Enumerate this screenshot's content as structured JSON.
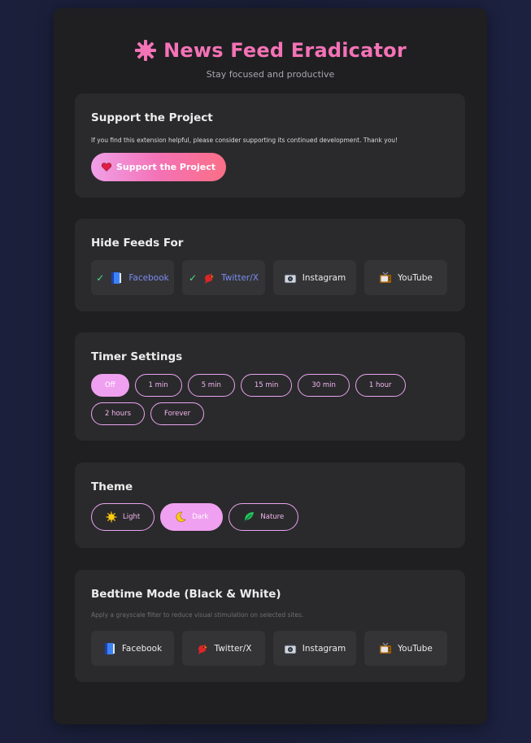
{
  "header": {
    "title": "News Feed Eradicator",
    "subtitle": "Stay focused and productive",
    "logo_icon": "pink-star-burst-icon"
  },
  "support": {
    "heading": "Support the Project",
    "description": "If you find this extension helpful, please consider supporting its continued development. Thank you!",
    "button_label": "Support the Project",
    "button_icon": "heart-icon"
  },
  "hide_feeds": {
    "heading": "Hide Feeds For",
    "sites": [
      {
        "label": "Facebook",
        "icon": "book-icon",
        "selected": true
      },
      {
        "label": "Twitter/X",
        "icon": "bird-icon",
        "selected": true
      },
      {
        "label": "Instagram",
        "icon": "camera-icon",
        "selected": false
      },
      {
        "label": "YouTube",
        "icon": "tv-icon",
        "selected": false
      }
    ]
  },
  "timer": {
    "heading": "Timer Settings",
    "options": [
      "Off",
      "1 min",
      "5 min",
      "15 min",
      "30 min",
      "1 hour",
      "2 hours",
      "Forever"
    ],
    "selected": "Off"
  },
  "theme": {
    "heading": "Theme",
    "options": [
      {
        "label": "Light",
        "icon": "sun-icon"
      },
      {
        "label": "Dark",
        "icon": "moon-icon"
      },
      {
        "label": "Nature",
        "icon": "leaf-icon"
      }
    ],
    "selected": "Dark"
  },
  "bedtime": {
    "heading": "Bedtime Mode (Black & White)",
    "description": "Apply a grayscale filter to reduce visual stimulation on selected sites.",
    "sites": [
      {
        "label": "Facebook",
        "icon": "book-icon"
      },
      {
        "label": "Twitter/X",
        "icon": "bird-icon"
      },
      {
        "label": "Instagram",
        "icon": "camera-icon"
      },
      {
        "label": "YouTube",
        "icon": "tv-icon"
      }
    ]
  },
  "colors": {
    "accent": "#f472b6",
    "pill": "#f0a0f0",
    "panel": "#1f1f21",
    "card": "#2a2a2c",
    "checked_link": "#7b8cf0",
    "check": "#4ade80"
  }
}
